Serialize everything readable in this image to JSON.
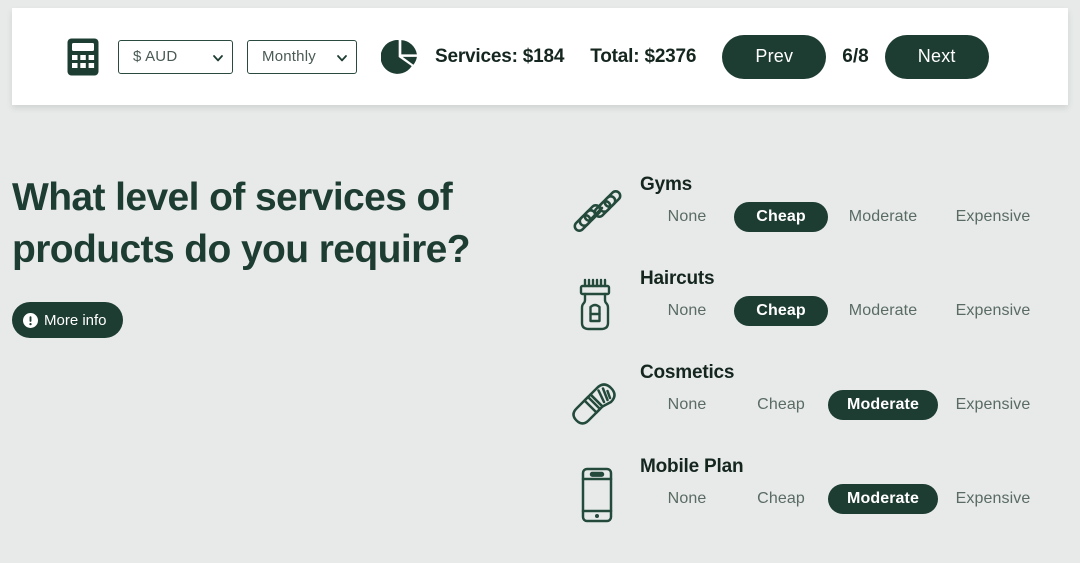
{
  "toolbar": {
    "calculator_icon": "calculator-icon",
    "currency_select": {
      "value": "$ AUD",
      "icon": "chevron-down-icon"
    },
    "frequency_select": {
      "value": "Monthly",
      "icon": "chevron-down-icon"
    },
    "pie_icon": "pie-chart-icon",
    "services_stat": "Services: $184",
    "total_stat": "Total: $2376",
    "prev_label": "Prev",
    "page_indicator": "6/8",
    "next_label": "Next"
  },
  "question": {
    "headline": "What level of services of products do you require?",
    "more_info_label": "More info",
    "more_info_icon": "exclamation-circle-icon"
  },
  "options": [
    {
      "label": "Gyms",
      "icon": "dumbbell-icon",
      "choices": [
        "None",
        "Cheap",
        "Moderate",
        "Expensive"
      ],
      "selected": "Cheap"
    },
    {
      "label": "Haircuts",
      "icon": "hair-clipper-icon",
      "choices": [
        "None",
        "Cheap",
        "Moderate",
        "Expensive"
      ],
      "selected": "Cheap"
    },
    {
      "label": "Cosmetics",
      "icon": "makeup-brush-icon",
      "choices": [
        "None",
        "Cheap",
        "Moderate",
        "Expensive"
      ],
      "selected": "Moderate"
    },
    {
      "label": "Mobile Plan",
      "icon": "smartphone-icon",
      "choices": [
        "None",
        "Cheap",
        "Moderate",
        "Expensive"
      ],
      "selected": "Moderate"
    }
  ],
  "colors": {
    "brand_dark_green": "#1d3c32",
    "page_background": "#e7eae9",
    "toolbar_background": "#ffffff",
    "muted_text": "#5a6b64"
  }
}
